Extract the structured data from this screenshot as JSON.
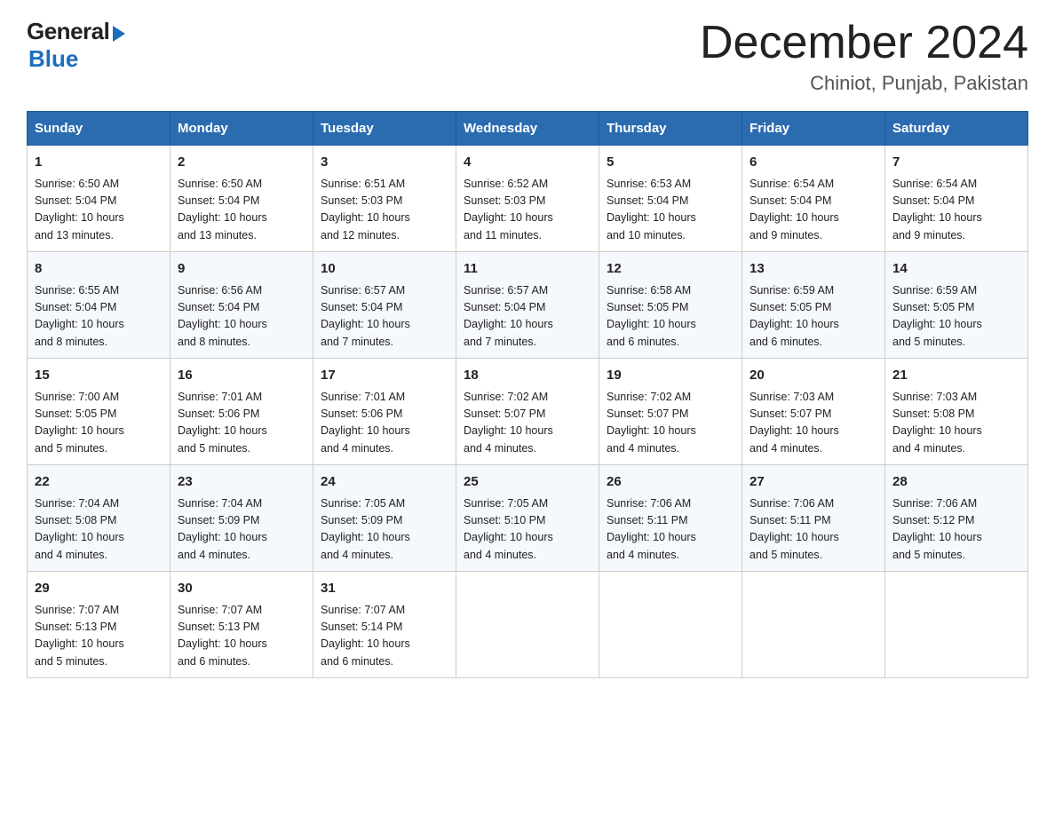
{
  "logo": {
    "general": "General",
    "blue": "Blue"
  },
  "title": {
    "month_year": "December 2024",
    "location": "Chiniot, Punjab, Pakistan"
  },
  "days_of_week": [
    "Sunday",
    "Monday",
    "Tuesday",
    "Wednesday",
    "Thursday",
    "Friday",
    "Saturday"
  ],
  "weeks": [
    [
      {
        "day": "1",
        "sunrise": "6:50 AM",
        "sunset": "5:04 PM",
        "daylight": "10 hours and 13 minutes."
      },
      {
        "day": "2",
        "sunrise": "6:50 AM",
        "sunset": "5:04 PM",
        "daylight": "10 hours and 13 minutes."
      },
      {
        "day": "3",
        "sunrise": "6:51 AM",
        "sunset": "5:03 PM",
        "daylight": "10 hours and 12 minutes."
      },
      {
        "day": "4",
        "sunrise": "6:52 AM",
        "sunset": "5:03 PM",
        "daylight": "10 hours and 11 minutes."
      },
      {
        "day": "5",
        "sunrise": "6:53 AM",
        "sunset": "5:04 PM",
        "daylight": "10 hours and 10 minutes."
      },
      {
        "day": "6",
        "sunrise": "6:54 AM",
        "sunset": "5:04 PM",
        "daylight": "10 hours and 9 minutes."
      },
      {
        "day": "7",
        "sunrise": "6:54 AM",
        "sunset": "5:04 PM",
        "daylight": "10 hours and 9 minutes."
      }
    ],
    [
      {
        "day": "8",
        "sunrise": "6:55 AM",
        "sunset": "5:04 PM",
        "daylight": "10 hours and 8 minutes."
      },
      {
        "day": "9",
        "sunrise": "6:56 AM",
        "sunset": "5:04 PM",
        "daylight": "10 hours and 8 minutes."
      },
      {
        "day": "10",
        "sunrise": "6:57 AM",
        "sunset": "5:04 PM",
        "daylight": "10 hours and 7 minutes."
      },
      {
        "day": "11",
        "sunrise": "6:57 AM",
        "sunset": "5:04 PM",
        "daylight": "10 hours and 7 minutes."
      },
      {
        "day": "12",
        "sunrise": "6:58 AM",
        "sunset": "5:05 PM",
        "daylight": "10 hours and 6 minutes."
      },
      {
        "day": "13",
        "sunrise": "6:59 AM",
        "sunset": "5:05 PM",
        "daylight": "10 hours and 6 minutes."
      },
      {
        "day": "14",
        "sunrise": "6:59 AM",
        "sunset": "5:05 PM",
        "daylight": "10 hours and 5 minutes."
      }
    ],
    [
      {
        "day": "15",
        "sunrise": "7:00 AM",
        "sunset": "5:05 PM",
        "daylight": "10 hours and 5 minutes."
      },
      {
        "day": "16",
        "sunrise": "7:01 AM",
        "sunset": "5:06 PM",
        "daylight": "10 hours and 5 minutes."
      },
      {
        "day": "17",
        "sunrise": "7:01 AM",
        "sunset": "5:06 PM",
        "daylight": "10 hours and 4 minutes."
      },
      {
        "day": "18",
        "sunrise": "7:02 AM",
        "sunset": "5:07 PM",
        "daylight": "10 hours and 4 minutes."
      },
      {
        "day": "19",
        "sunrise": "7:02 AM",
        "sunset": "5:07 PM",
        "daylight": "10 hours and 4 minutes."
      },
      {
        "day": "20",
        "sunrise": "7:03 AM",
        "sunset": "5:07 PM",
        "daylight": "10 hours and 4 minutes."
      },
      {
        "day": "21",
        "sunrise": "7:03 AM",
        "sunset": "5:08 PM",
        "daylight": "10 hours and 4 minutes."
      }
    ],
    [
      {
        "day": "22",
        "sunrise": "7:04 AM",
        "sunset": "5:08 PM",
        "daylight": "10 hours and 4 minutes."
      },
      {
        "day": "23",
        "sunrise": "7:04 AM",
        "sunset": "5:09 PM",
        "daylight": "10 hours and 4 minutes."
      },
      {
        "day": "24",
        "sunrise": "7:05 AM",
        "sunset": "5:09 PM",
        "daylight": "10 hours and 4 minutes."
      },
      {
        "day": "25",
        "sunrise": "7:05 AM",
        "sunset": "5:10 PM",
        "daylight": "10 hours and 4 minutes."
      },
      {
        "day": "26",
        "sunrise": "7:06 AM",
        "sunset": "5:11 PM",
        "daylight": "10 hours and 4 minutes."
      },
      {
        "day": "27",
        "sunrise": "7:06 AM",
        "sunset": "5:11 PM",
        "daylight": "10 hours and 5 minutes."
      },
      {
        "day": "28",
        "sunrise": "7:06 AM",
        "sunset": "5:12 PM",
        "daylight": "10 hours and 5 minutes."
      }
    ],
    [
      {
        "day": "29",
        "sunrise": "7:07 AM",
        "sunset": "5:13 PM",
        "daylight": "10 hours and 5 minutes."
      },
      {
        "day": "30",
        "sunrise": "7:07 AM",
        "sunset": "5:13 PM",
        "daylight": "10 hours and 6 minutes."
      },
      {
        "day": "31",
        "sunrise": "7:07 AM",
        "sunset": "5:14 PM",
        "daylight": "10 hours and 6 minutes."
      },
      null,
      null,
      null,
      null
    ]
  ],
  "labels": {
    "sunrise": "Sunrise:",
    "sunset": "Sunset:",
    "daylight": "Daylight:"
  }
}
